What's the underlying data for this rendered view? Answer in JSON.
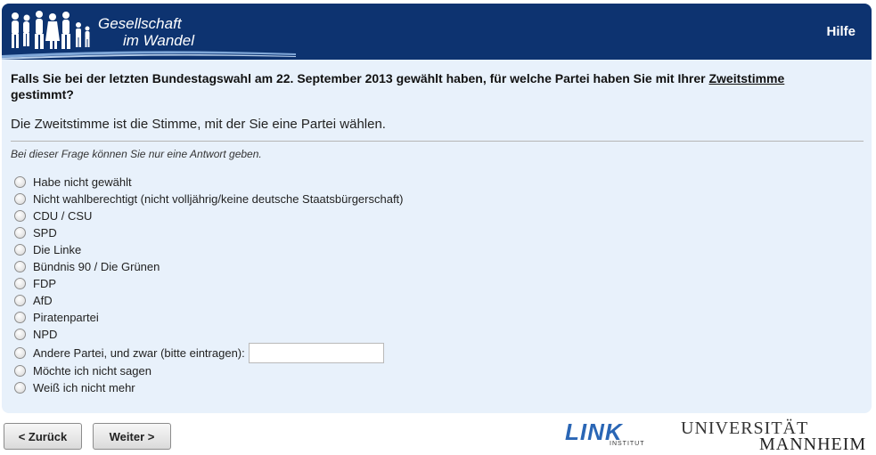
{
  "header": {
    "logo_line1": "Gesellschaft",
    "logo_line2": "im Wandel",
    "help_label": "Hilfe",
    "bg_color": "#0d3370"
  },
  "question": {
    "text_before": "Falls Sie bei der letzten Bundestagswahl am 22. September 2013 gewählt haben, für welche Partei haben Sie mit Ihrer ",
    "term": "Zweitstimme",
    "text_after": " gestimmt?"
  },
  "explanation": "Die Zweitstimme ist die Stimme, mit der Sie eine Partei wählen.",
  "instruction": "Bei dieser Frage können Sie nur eine Antwort geben.",
  "options": [
    "Habe nicht gewählt",
    "Nicht wahlberechtigt (nicht volljährig/keine deutsche Staatsbürgerschaft)",
    "CDU / CSU",
    "SPD",
    "Die Linke",
    "Bündnis 90 / Die Grünen",
    "FDP",
    "AfD",
    "Piratenpartei",
    "NPD",
    "Andere Partei, und zwar (bitte eintragen):",
    "Möchte ich nicht sagen",
    "Weiß ich nicht mehr"
  ],
  "other_party_value": "",
  "nav": {
    "back_label": "< Zurück",
    "next_label": "Weiter >"
  },
  "logos": {
    "link_word": "LINK",
    "link_sub": "INSTITUT",
    "uni_line1": "UNIVERSITÄT",
    "uni_line2": "MANNHEIM"
  }
}
